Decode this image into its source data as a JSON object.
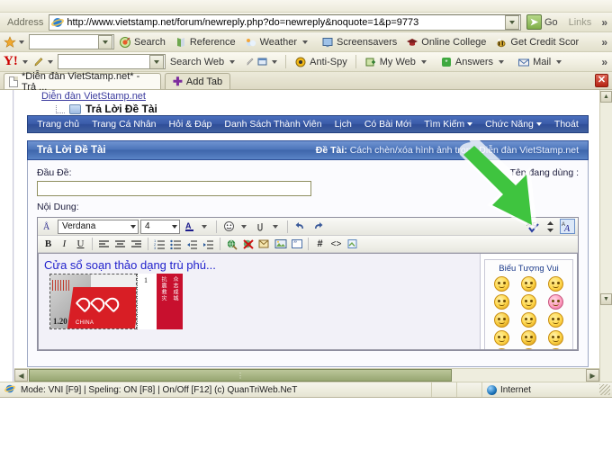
{
  "browser": {
    "address_label": "Address",
    "url": "http://www.vietstamp.net/forum/newreply.php?do=newreply&noquote=1&p=9773",
    "go_label": "Go",
    "links_label": "Links",
    "chevron": "»",
    "close_label": "✕"
  },
  "toolbar2": {
    "search_value": "",
    "items": [
      {
        "label": "Search",
        "icon": "target-icon"
      },
      {
        "label": "Reference",
        "icon": "book-icon"
      },
      {
        "label": "Weather",
        "icon": "cloud-icon",
        "caret": true
      },
      {
        "label": "Screensavers",
        "icon": "monitor-icon"
      },
      {
        "label": "Online College",
        "icon": "graduation-cap-icon"
      },
      {
        "label": "Get Credit Scor",
        "icon": "bee-icon"
      }
    ]
  },
  "yahoo_toolbar": {
    "logo": "Y!",
    "search_value": "",
    "search_button": "Search Web",
    "items": [
      {
        "label": "Anti-Spy",
        "icon": "antispy-icon"
      },
      {
        "label": "My Web",
        "icon": "myweb-icon"
      },
      {
        "label": "Answers",
        "icon": "answers-icon"
      },
      {
        "label": "Mail",
        "icon": "mail-icon"
      }
    ]
  },
  "tabs": {
    "active_tab": "*Diễn đàn VietStamp.net* - Trả ...",
    "add_tab": "Add Tab"
  },
  "page": {
    "breadcrumb_link": "Diễn đàn VietStamp.net",
    "breadcrumb_current": "Trả Lời Đề Tài",
    "nav": [
      {
        "label": "Trang chủ",
        "caret": false
      },
      {
        "label": "Trang Cá Nhân",
        "caret": false
      },
      {
        "label": "Hỏi & Đáp",
        "caret": false
      },
      {
        "label": "Danh Sách Thành Viên",
        "caret": false
      },
      {
        "label": "Lịch",
        "caret": false
      },
      {
        "label": "Có Bài Mới",
        "caret": false
      },
      {
        "label": "Tìm Kiếm",
        "caret": true
      },
      {
        "label": "Chức Năng",
        "caret": true
      },
      {
        "label": "Thoát",
        "caret": false
      }
    ]
  },
  "form": {
    "panel_title": "Trả Lời Đề Tài",
    "topic_prefix": "Đề Tài:",
    "topic_name": "Cách chèn/xóa hình ảnh trong Diễn đàn VietStamp.net",
    "title_label": "Đầu Đề:",
    "title_value": "",
    "username_label": "Tên đang dùng :",
    "username_value": "",
    "content_label": "Nội Dung:"
  },
  "editor": {
    "font_family": "Verdana",
    "font_size": "4",
    "row1_buttons": [
      {
        "name": "remove-format-icon",
        "glyph": "Å"
      },
      {
        "name": "font-color-icon",
        "glyph": "A"
      },
      {
        "name": "smiley-dropdown-icon",
        "glyph": "☺"
      },
      {
        "name": "attach-icon",
        "glyph": "\u0001"
      },
      {
        "name": "undo-icon",
        "glyph": "↶"
      },
      {
        "name": "redo-icon",
        "glyph": "↷"
      },
      {
        "name": "spellcheck-icon",
        "glyph": "✓"
      },
      {
        "name": "updown-icon",
        "glyph": "↕"
      },
      {
        "name": "wysiwyg-toggle-icon",
        "glyph": "A"
      }
    ],
    "row2_buttons": [
      {
        "name": "bold-button",
        "glyph": "B"
      },
      {
        "name": "italic-button",
        "glyph": "I"
      },
      {
        "name": "underline-button",
        "glyph": "U"
      },
      {
        "name": "align-left-button",
        "glyph": "≡"
      },
      {
        "name": "align-center-button",
        "glyph": "≡"
      },
      {
        "name": "align-right-button",
        "glyph": "≡"
      },
      {
        "name": "ordered-list-button",
        "glyph": "≣"
      },
      {
        "name": "unordered-list-button",
        "glyph": "≣"
      },
      {
        "name": "outdent-button",
        "glyph": "⇤"
      },
      {
        "name": "indent-button",
        "glyph": "⇥"
      },
      {
        "name": "insert-link-button",
        "glyph": "●"
      },
      {
        "name": "remove-link-button",
        "glyph": "✖"
      },
      {
        "name": "insert-email-button",
        "glyph": "✉"
      },
      {
        "name": "insert-image-button",
        "glyph": "▣"
      },
      {
        "name": "insert-quote-button",
        "glyph": "“"
      },
      {
        "name": "insert-code-hash-button",
        "glyph": "#"
      },
      {
        "name": "insert-html-button",
        "glyph": "<>"
      },
      {
        "name": "insert-attachment-button",
        "glyph": "❐"
      }
    ],
    "content_text": "Cửa sổ soạn thảo dạng trù phú...",
    "content_color": "#2222cc"
  },
  "smilies": {
    "title": "Biểu Tượng Vui",
    "grid": [
      [
        "laugh",
        "silly",
        "wink-wave"
      ],
      [
        "sick",
        "sleepy",
        "angry-pink"
      ],
      [
        "love",
        "confused",
        "smile"
      ],
      [
        "tongue",
        "blush",
        "neutral"
      ],
      [
        "grin",
        "shy",
        "wave"
      ]
    ]
  },
  "statusbar": {
    "message": "Mode: VNI [F9] | Speling: ON [F8] | On/Off [F12] (c) QuanTriWeb.NeT",
    "zone": "Internet"
  },
  "colors": {
    "nav_blue": "#3a5ba8",
    "panel_header_blue": "#4d75ba",
    "link_blue": "#3b3b9e",
    "editor_text_blue": "#2222cc",
    "toolbar_olive": "#e6e4d2",
    "scroll_green": "#97a672",
    "close_red": "#b52314",
    "arrow_green": "#3fc43f"
  }
}
